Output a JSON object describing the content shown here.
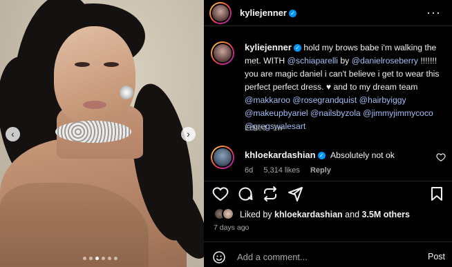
{
  "post": {
    "author": "kyliejenner",
    "verified": true,
    "more_icon": "more-horizontal-icon",
    "media": {
      "slides": 6,
      "active_slide": 2,
      "prev_icon": "chevron-left-icon",
      "next_icon": "chevron-right-icon"
    },
    "caption": {
      "author": "kyliejenner",
      "segments": [
        {
          "text": "hold my brows babe i'm walking the met. WITH ",
          "mention": false
        },
        {
          "text": "@schiaparelli",
          "mention": true
        },
        {
          "text": " by ",
          "mention": false
        },
        {
          "text": "@danielroseberry",
          "mention": true
        },
        {
          "text": " !!!!!!! you are magic daniel i can't believe i get to wear this perfect perfect dress. ♥  and to my dream team ",
          "mention": false
        },
        {
          "text": "@makkaroo",
          "mention": true
        },
        {
          "text": " ",
          "mention": false
        },
        {
          "text": "@rosegrandquist",
          "mention": true
        },
        {
          "text": " ",
          "mention": false
        },
        {
          "text": "@hairbyiggy",
          "mention": true
        },
        {
          "text": " ",
          "mention": false
        },
        {
          "text": "@makeupbyariel",
          "mention": true
        },
        {
          "text": " ",
          "mention": false
        },
        {
          "text": "@nailsbyzola",
          "mention": true
        },
        {
          "text": " ",
          "mention": false
        },
        {
          "text": "@jimmyjimmycoco",
          "mention": true
        },
        {
          "text": " ",
          "mention": false
        },
        {
          "text": "@gregswalesart",
          "mention": true
        }
      ],
      "meta": "Edited · 1w"
    },
    "comments": [
      {
        "author": "khloekardashian",
        "verified": true,
        "text": "Absolutely not ok",
        "age": "6d",
        "likes": "5,314 likes",
        "reply_label": "Reply",
        "like_icon": "heart-outline-icon"
      }
    ],
    "actions": {
      "like_icon": "heart-outline-icon",
      "comment_icon": "comment-bubble-icon",
      "repost_icon": "repost-icon",
      "share_icon": "paper-plane-icon",
      "save_icon": "bookmark-icon"
    },
    "likes": {
      "prefix": "Liked by ",
      "user": "khloekardashian",
      "connector": " and ",
      "others": "3.5M others"
    },
    "date": "7 days ago",
    "add_comment": {
      "emoji_icon": "smiley-icon",
      "placeholder": "Add a comment...",
      "post_label": "Post"
    }
  },
  "colors": {
    "background": "#000000",
    "mention": "#a5bdf5",
    "verified": "#0095f6",
    "muted": "#a8a8a8"
  }
}
